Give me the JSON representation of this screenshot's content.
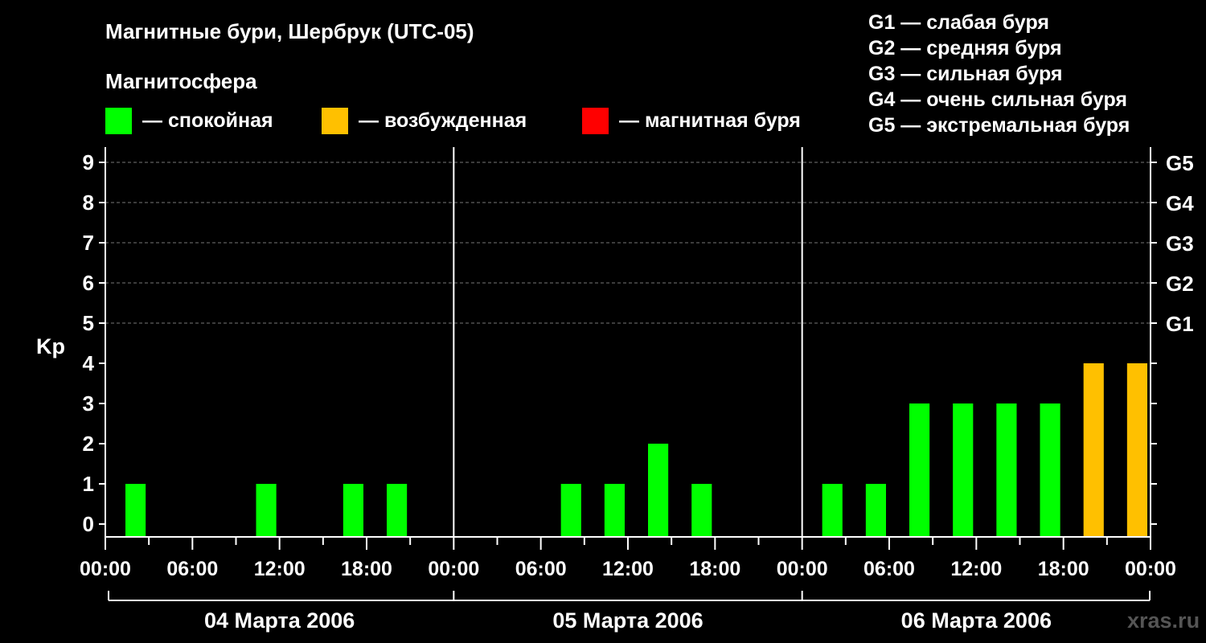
{
  "title": "Магнитные бури, Шербрук (UTC-05)",
  "magnetosphere_heading": "Магнитосфера",
  "legend": [
    {
      "label": "— спокойная",
      "color": "#00ff00"
    },
    {
      "label": "— возбужденная",
      "color": "#ffc000"
    },
    {
      "label": "— магнитная буря",
      "color": "#ff0000"
    }
  ],
  "storm_scale": [
    "G1 — слабая буря",
    "G2 — средняя буря",
    "G3 — сильная буря",
    "G4 — очень сильная буря",
    "G5 — экстремальная буря"
  ],
  "watermark": "xras.ru",
  "chart_data": {
    "type": "bar",
    "title": "Магнитные бури, Шербрук (UTC-05)",
    "ylabel": "Kp",
    "ylim": [
      0,
      9
    ],
    "yticks": [
      "0",
      "1",
      "2",
      "3",
      "4",
      "5",
      "6",
      "7",
      "8",
      "9"
    ],
    "right_axis_labels": [
      {
        "kp": 5,
        "label": "G1"
      },
      {
        "kp": 6,
        "label": "G2"
      },
      {
        "kp": 7,
        "label": "G3"
      },
      {
        "kp": 8,
        "label": "G4"
      },
      {
        "kp": 9,
        "label": "G5"
      }
    ],
    "xtick_labels": [
      "00:00",
      "06:00",
      "12:00",
      "18:00",
      "00:00",
      "06:00",
      "12:00",
      "18:00",
      "00:00",
      "06:00",
      "12:00",
      "18:00",
      "00:00"
    ],
    "days": [
      "04 Марта 2006",
      "05 Марта 2006",
      "06 Марта 2006"
    ],
    "interval_hours": 3,
    "kp_values": [
      [
        1,
        null,
        null,
        1,
        null,
        1,
        1,
        null
      ],
      [
        null,
        null,
        1,
        1,
        2,
        1,
        null,
        null
      ],
      [
        1,
        1,
        3,
        3,
        3,
        3,
        4,
        4
      ]
    ],
    "color_thresholds": {
      "quiet_below": 4,
      "storm_from": 5
    },
    "grid": "dashed at Kp 5–9"
  }
}
